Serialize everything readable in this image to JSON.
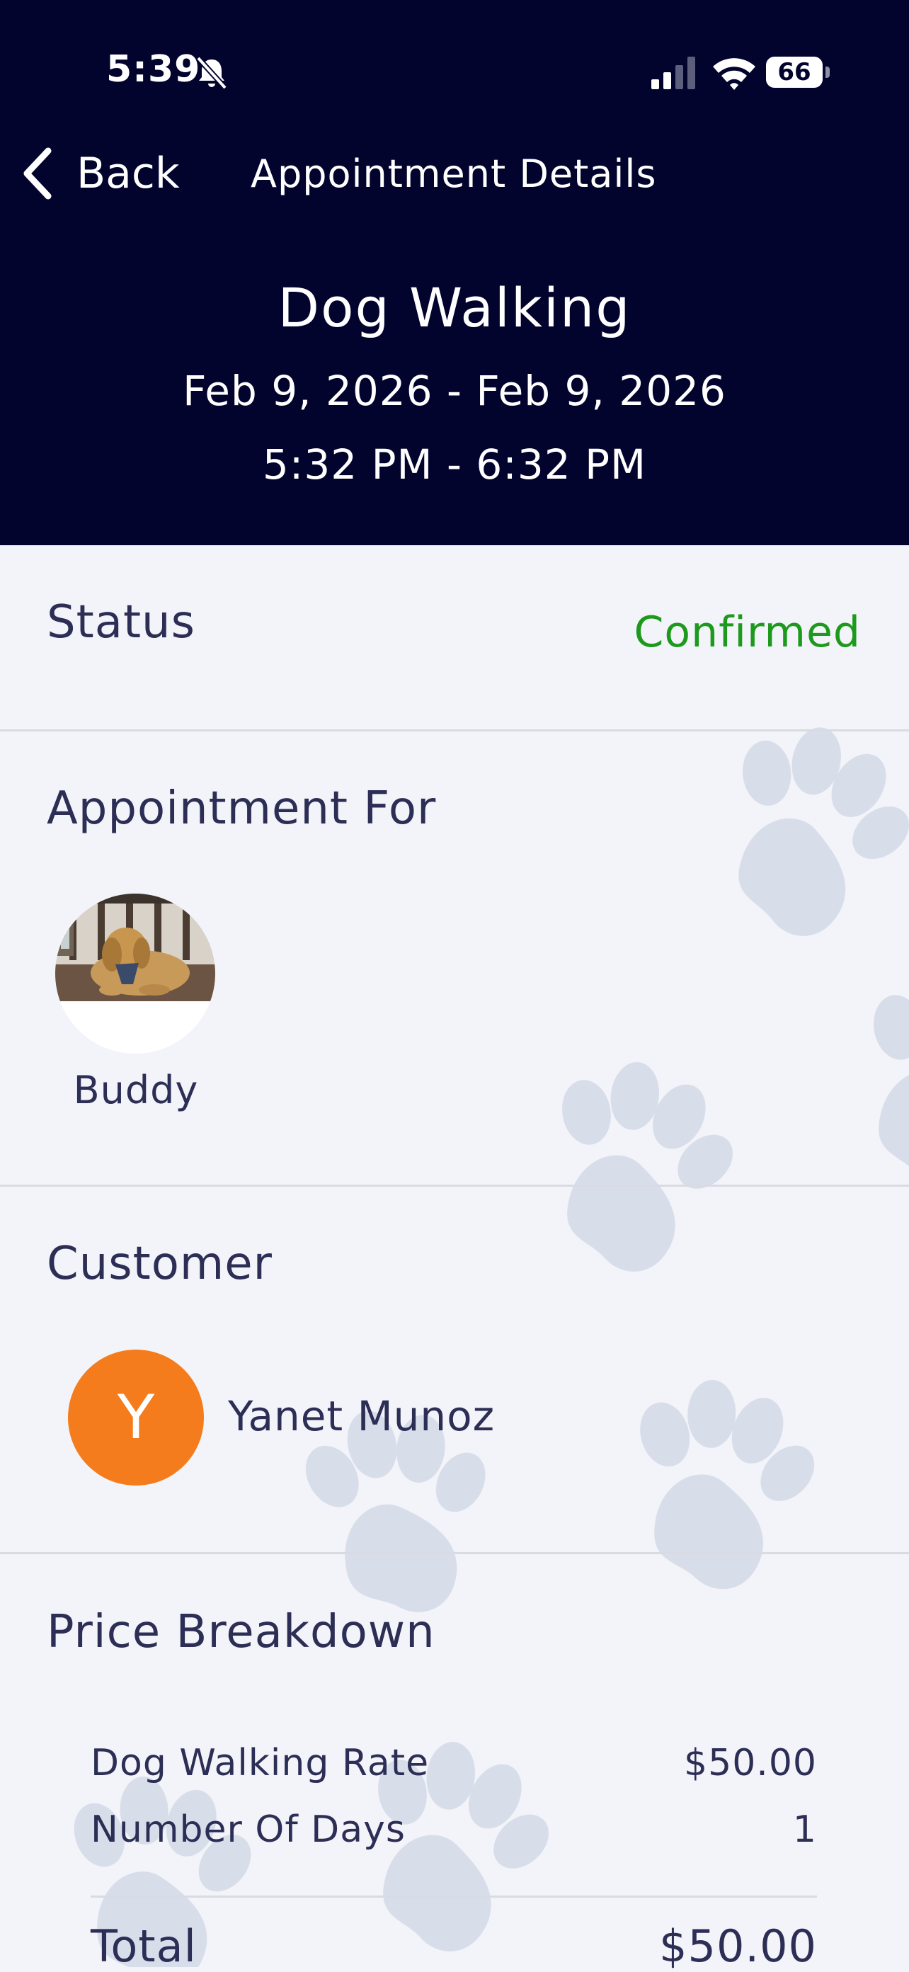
{
  "status_bar": {
    "time": "5:39",
    "battery": "66"
  },
  "nav": {
    "back_label": "Back",
    "title": "Appointment Details"
  },
  "appointment": {
    "service": "Dog Walking",
    "date_range": "Feb 9, 2026 - Feb 9, 2026",
    "time_range": "5:32 PM - 6:32 PM"
  },
  "status": {
    "label": "Status",
    "value": "Confirmed",
    "color": "#1d9a1d"
  },
  "appointment_for": {
    "label": "Appointment For",
    "pets": [
      {
        "name": "Buddy"
      }
    ]
  },
  "customer": {
    "label": "Customer",
    "initial": "Y",
    "name": "Yanet Munoz",
    "avatar_color": "#f47c1d"
  },
  "price_breakdown": {
    "label": "Price Breakdown",
    "items": [
      {
        "label": "Dog Walking Rate",
        "value": "$50.00"
      },
      {
        "label": "Number Of Days",
        "value": "1"
      }
    ],
    "total_label": "Total",
    "total_value": "$50.00"
  },
  "colors": {
    "header_bg": "#02042e",
    "page_bg": "#f3f4f9"
  }
}
